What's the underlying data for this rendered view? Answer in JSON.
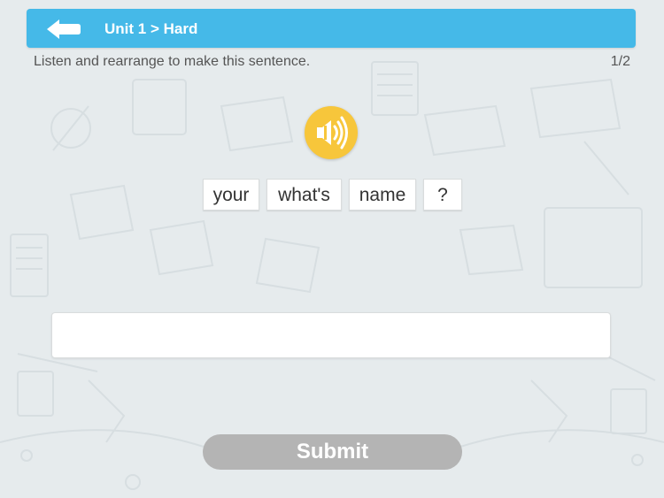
{
  "header": {
    "back_icon": "back-arrow-icon",
    "title": "Unit 1 > Hard",
    "color": "#45b9e8"
  },
  "exercise": {
    "instruction": "Listen and rearrange to make this sentence.",
    "progress": "1/2",
    "audio_icon": "speaker-icon",
    "audio_color": "#f7c63b",
    "words": [
      "your",
      "what's",
      "name",
      "?"
    ],
    "answer_value": ""
  },
  "submit": {
    "label": "Submit",
    "color": "#b4b4b4"
  }
}
